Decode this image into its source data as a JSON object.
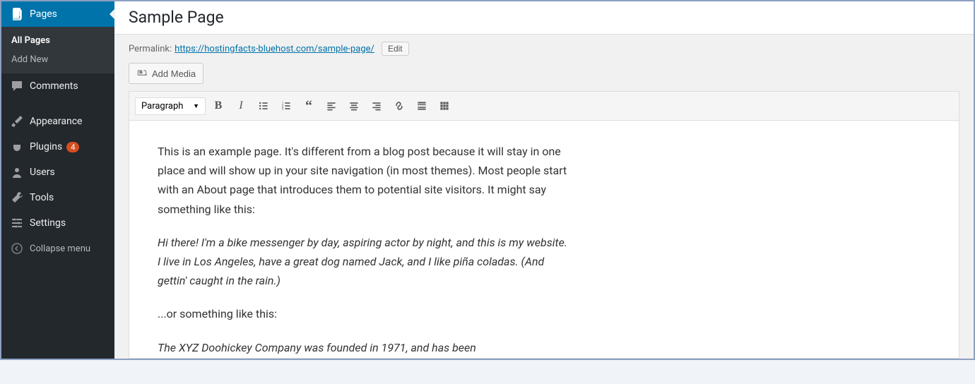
{
  "sidebar": {
    "pages": {
      "label": "Pages",
      "sub_all": "All Pages",
      "sub_add": "Add New"
    },
    "comments": {
      "label": "Comments"
    },
    "appearance": {
      "label": "Appearance"
    },
    "plugins": {
      "label": "Plugins",
      "badge": "4"
    },
    "users": {
      "label": "Users"
    },
    "tools": {
      "label": "Tools"
    },
    "settings": {
      "label": "Settings"
    },
    "collapse": {
      "label": "Collapse menu"
    }
  },
  "header": {
    "title": "Sample Page",
    "permalink_label": "Permalink:",
    "permalink_url": "https://hostingfacts-bluehost.com/sample-page/",
    "edit_label": "Edit"
  },
  "media": {
    "add_media": "Add Media"
  },
  "toolbar": {
    "format_selected": "Paragraph"
  },
  "content": {
    "p1": "This is an example page. It's different from a blog post because it will stay in one place and will show up in your site navigation (in most themes). Most people start with an About page that introduces them to potential site visitors. It might say something like this:",
    "p2": "Hi there! I'm a bike messenger by day, aspiring actor by night, and this is my website. I live in Los Angeles, have a great dog named Jack, and I like piña coladas. (And gettin' caught in the rain.)",
    "p3": "...or something like this:",
    "p4": "The XYZ Doohickey Company was founded in 1971, and has been"
  }
}
